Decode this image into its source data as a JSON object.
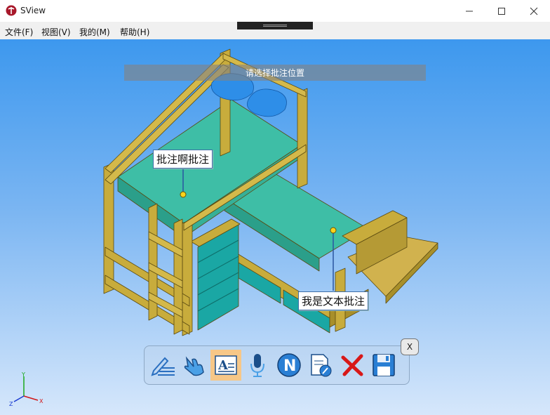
{
  "window": {
    "title": "SView",
    "controls": [
      "minimize",
      "maximize",
      "close"
    ]
  },
  "menu": {
    "items": [
      "文件(F)",
      "视图(V)",
      "我的(M)",
      "帮助(H)"
    ]
  },
  "viewport": {
    "hint": "请选择批注位置",
    "annotations": [
      {
        "text": "批注啊批注"
      },
      {
        "text": "我是文本批注"
      }
    ],
    "model_colors": {
      "frame": "#c8ac3c",
      "mattress": "#3ebea6",
      "pillow": "#2e8ee8",
      "drawer": "#1aa7a4",
      "background_top": "#3d98ee",
      "background_bottom": "#d6e7fb"
    }
  },
  "annotation_toolbar": {
    "tools": [
      {
        "name": "sketch-annotation",
        "icon": "pen-lines-icon",
        "active": false
      },
      {
        "name": "gesture-annotation",
        "icon": "hand-pointer-icon",
        "active": false
      },
      {
        "name": "text-annotation",
        "icon": "text-note-icon",
        "active": true
      },
      {
        "name": "voice-annotation",
        "icon": "microphone-icon",
        "active": false
      },
      {
        "name": "note-annotation",
        "icon": "n-circle-icon",
        "active": false
      },
      {
        "name": "edit-annotation",
        "icon": "doc-edit-icon",
        "active": false
      },
      {
        "name": "delete-annotation",
        "icon": "red-x-icon",
        "active": false
      },
      {
        "name": "save-annotation",
        "icon": "floppy-disk-icon",
        "active": false
      }
    ],
    "close_label": "X"
  },
  "axis_triad": {
    "labels": [
      "Y",
      "Z",
      "X"
    ]
  }
}
